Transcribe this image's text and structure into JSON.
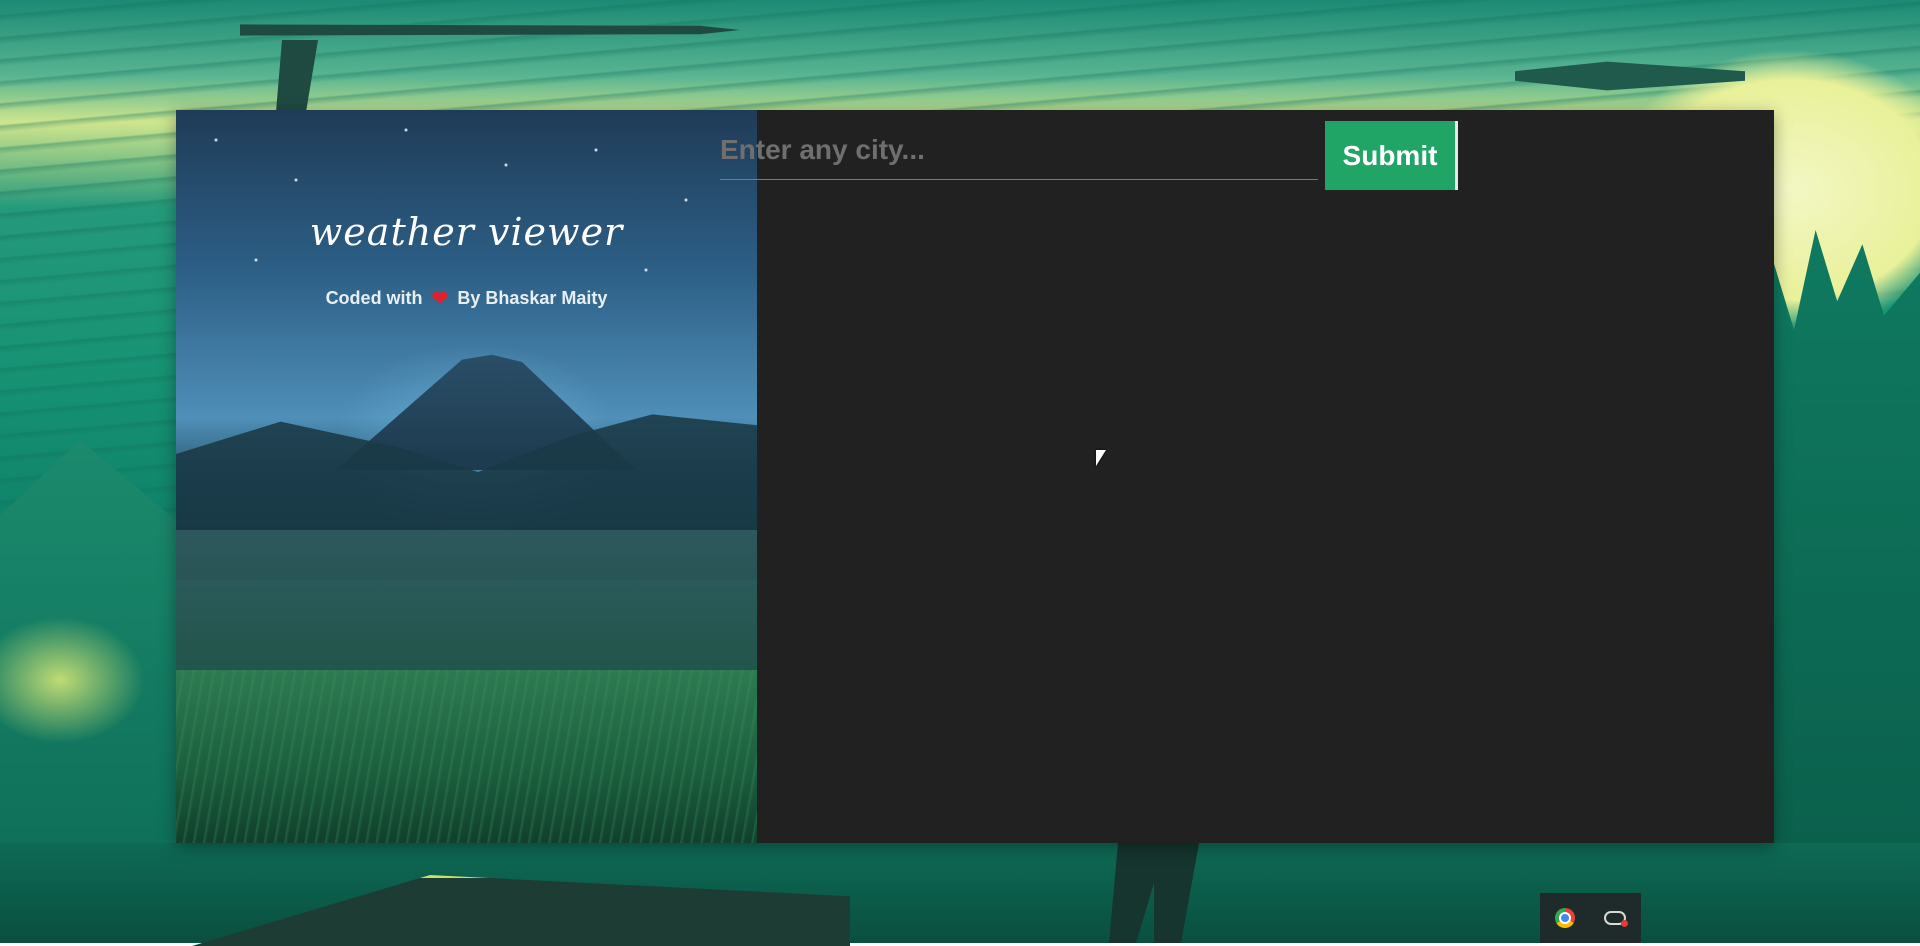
{
  "app": {
    "title": "weather viewer",
    "credit_prefix": "Coded with",
    "credit_suffix": "By Bhaskar Maity"
  },
  "icons": {
    "heart": "heart-icon",
    "cursor": "cursor-icon",
    "tray": [
      "chrome-icon",
      "game-controller-icon"
    ]
  },
  "search": {
    "placeholder": "Enter any city...",
    "value": "",
    "submit_label": "Submit"
  },
  "colors": {
    "accent": "#21a566",
    "panel_bg": "#212121",
    "heart": "#e0202a"
  }
}
